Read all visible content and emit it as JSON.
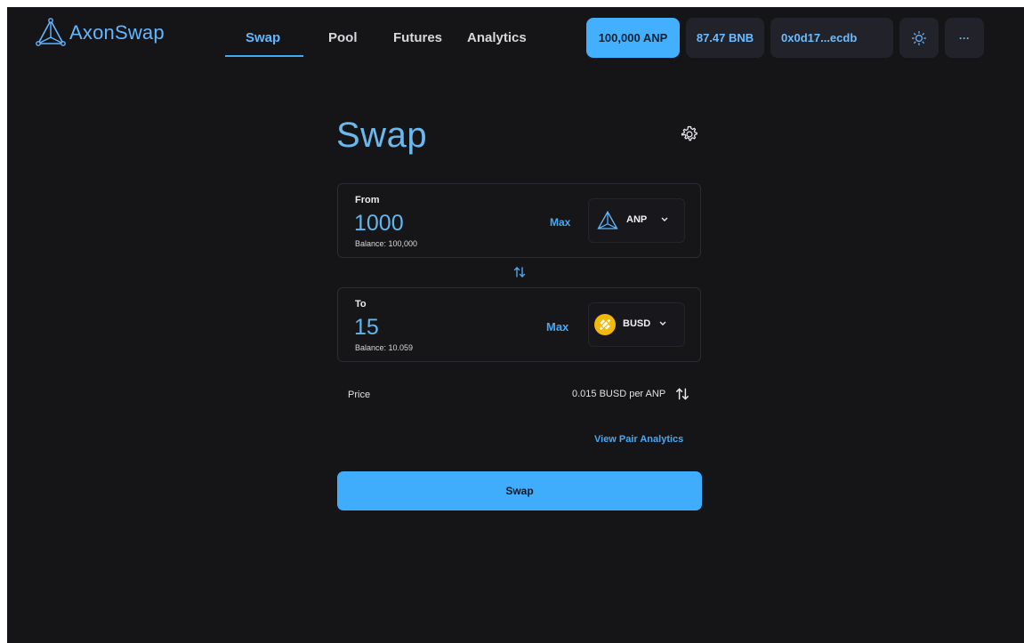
{
  "brand": {
    "name": "AxonSwap",
    "logo_icon": "axon-triangle-icon",
    "accent": "#42b0ff"
  },
  "nav": {
    "tabs": [
      {
        "label": "Swap",
        "active": true
      },
      {
        "label": "Pool",
        "active": false
      },
      {
        "label": "Futures",
        "active": false
      },
      {
        "label": "Analytics",
        "active": false
      }
    ]
  },
  "header": {
    "anp_balance": "100,000 ANP",
    "bnb_balance": "87.47 BNB",
    "wallet_address": "0x0d17...ecdb",
    "theme_icon": "sun-icon",
    "more_label": "···"
  },
  "swap": {
    "title": "Swap",
    "settings_icon": "gear-icon",
    "from": {
      "label": "From",
      "amount": "1000",
      "balance": "Balance:  100,000",
      "max_label": "Max",
      "token": "ANP",
      "token_icon": "axon-triangle-icon"
    },
    "to": {
      "label": "To",
      "amount": "15",
      "balance": "Balance:  10.059",
      "max_label": "Max",
      "token": "BUSD",
      "token_icon": "busd-coin-icon"
    },
    "price_label": "Price",
    "price_value": "0.015 BUSD per ANP",
    "pair_analytics_label": "View Pair Analytics",
    "submit_label": "Swap"
  }
}
